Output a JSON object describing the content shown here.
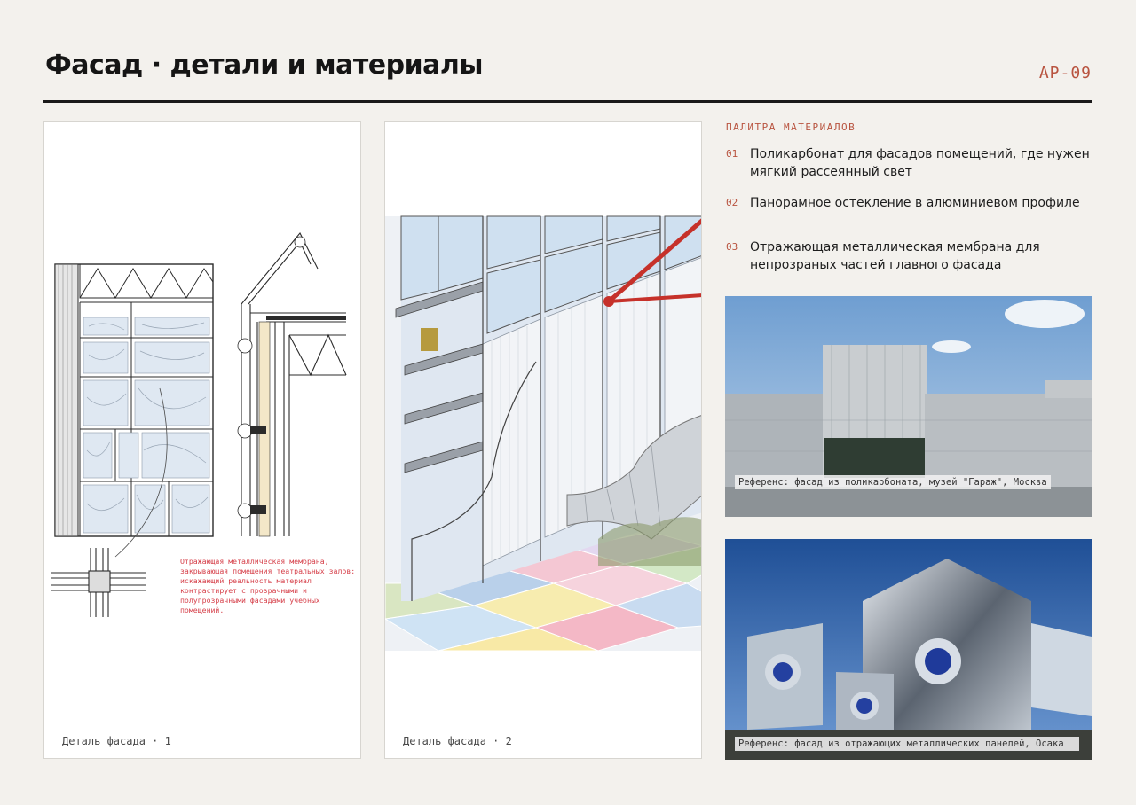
{
  "header": {
    "title": "Фасад · детали и материалы",
    "code": "АР-09"
  },
  "cards": [
    {
      "caption": "Деталь фасада · 1",
      "note": "Отражающая металлическая мембрана, закрывающая помещения театральных залов: искажающий реальность материал контрастирует с прозрачными и полупрозрачными фасадами учебных помещений."
    },
    {
      "caption": "Деталь фасада · 2"
    }
  ],
  "palette": {
    "title": "ПАЛИТРА МАТЕРИАЛОВ",
    "items": [
      {
        "num": "01",
        "text": "Поликарбонат для фасадов помещений, где нужен мягкий рассеянный свет"
      },
      {
        "num": "02",
        "text": "Панорамное остекление в алюминиевом профиле"
      },
      {
        "num": "03",
        "text": "Отражающая металлическая мембрана для непрозраных частей главного фасада"
      }
    ]
  },
  "references": [
    {
      "caption": "Референс: фасад из поликарбоната, музей \"Гараж\", Москва"
    },
    {
      "caption": "Референс: фасад из отражающих металлических панелей, Осака"
    }
  ],
  "colors": {
    "accent": "#b8533f",
    "note_red": "#d6404a",
    "rule": "#1a1a1a",
    "background": "#f3f1ed"
  }
}
